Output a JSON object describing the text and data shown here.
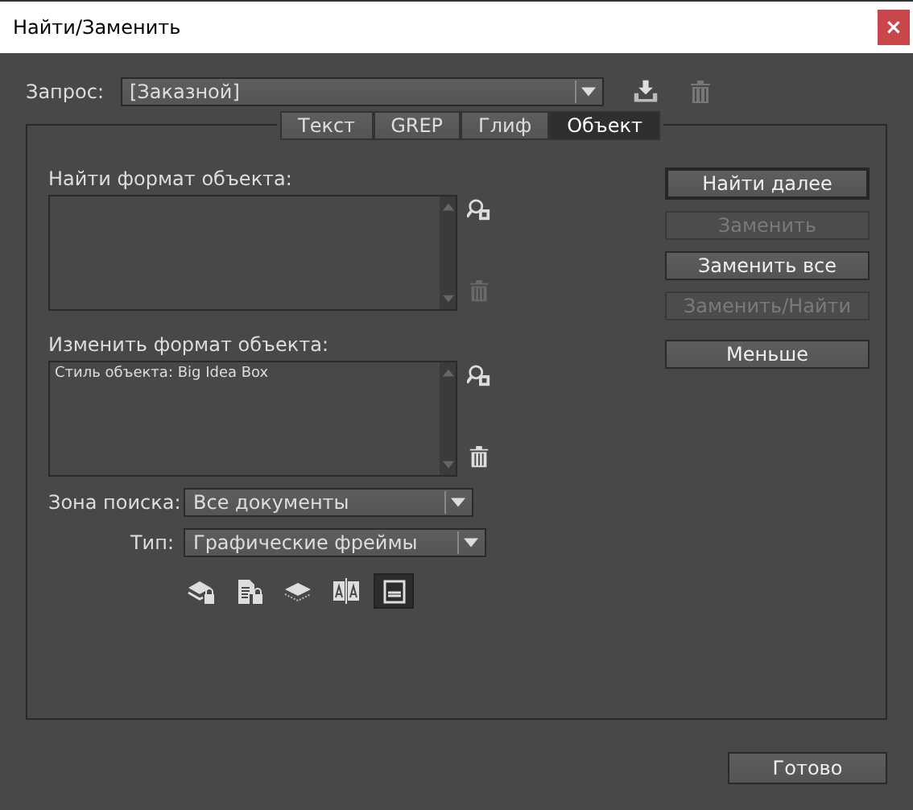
{
  "window": {
    "title": "Найти/Заменить",
    "close": "×"
  },
  "query": {
    "label": "Запрос:",
    "value": "[Заказной]"
  },
  "tabs": [
    {
      "label": "Текст",
      "selected": false
    },
    {
      "label": "GREP",
      "selected": false
    },
    {
      "label": "Глиф",
      "selected": false
    },
    {
      "label": "Объект",
      "selected": true
    }
  ],
  "find_format": {
    "label": "Найти формат объекта:",
    "delete_disabled": true
  },
  "change_format": {
    "label": "Изменить формат объекта:",
    "value": "Стиль объекта: Big Idea Box",
    "delete_disabled": false
  },
  "search_zone": {
    "label": "Зона поиска:",
    "value": "Все документы"
  },
  "type": {
    "label": "Тип:",
    "value": "Графические фреймы"
  },
  "toggles": [
    {
      "kind": "locked-layers",
      "selected": false
    },
    {
      "kind": "locked-items",
      "selected": false
    },
    {
      "kind": "hidden-layers",
      "selected": false
    },
    {
      "kind": "master-pages",
      "selected": false
    },
    {
      "kind": "footnotes",
      "selected": true
    }
  ],
  "buttons": [
    {
      "label": "Найти далее",
      "disabled": false,
      "default": true
    },
    {
      "label": "Заменить",
      "disabled": true,
      "default": false
    },
    {
      "label": "Заменить все",
      "disabled": false,
      "default": false
    },
    {
      "label": "Заменить/Найти",
      "disabled": true,
      "default": false
    },
    {
      "label": "Меньше",
      "disabled": false,
      "default": false
    }
  ],
  "done_button": "Готово"
}
